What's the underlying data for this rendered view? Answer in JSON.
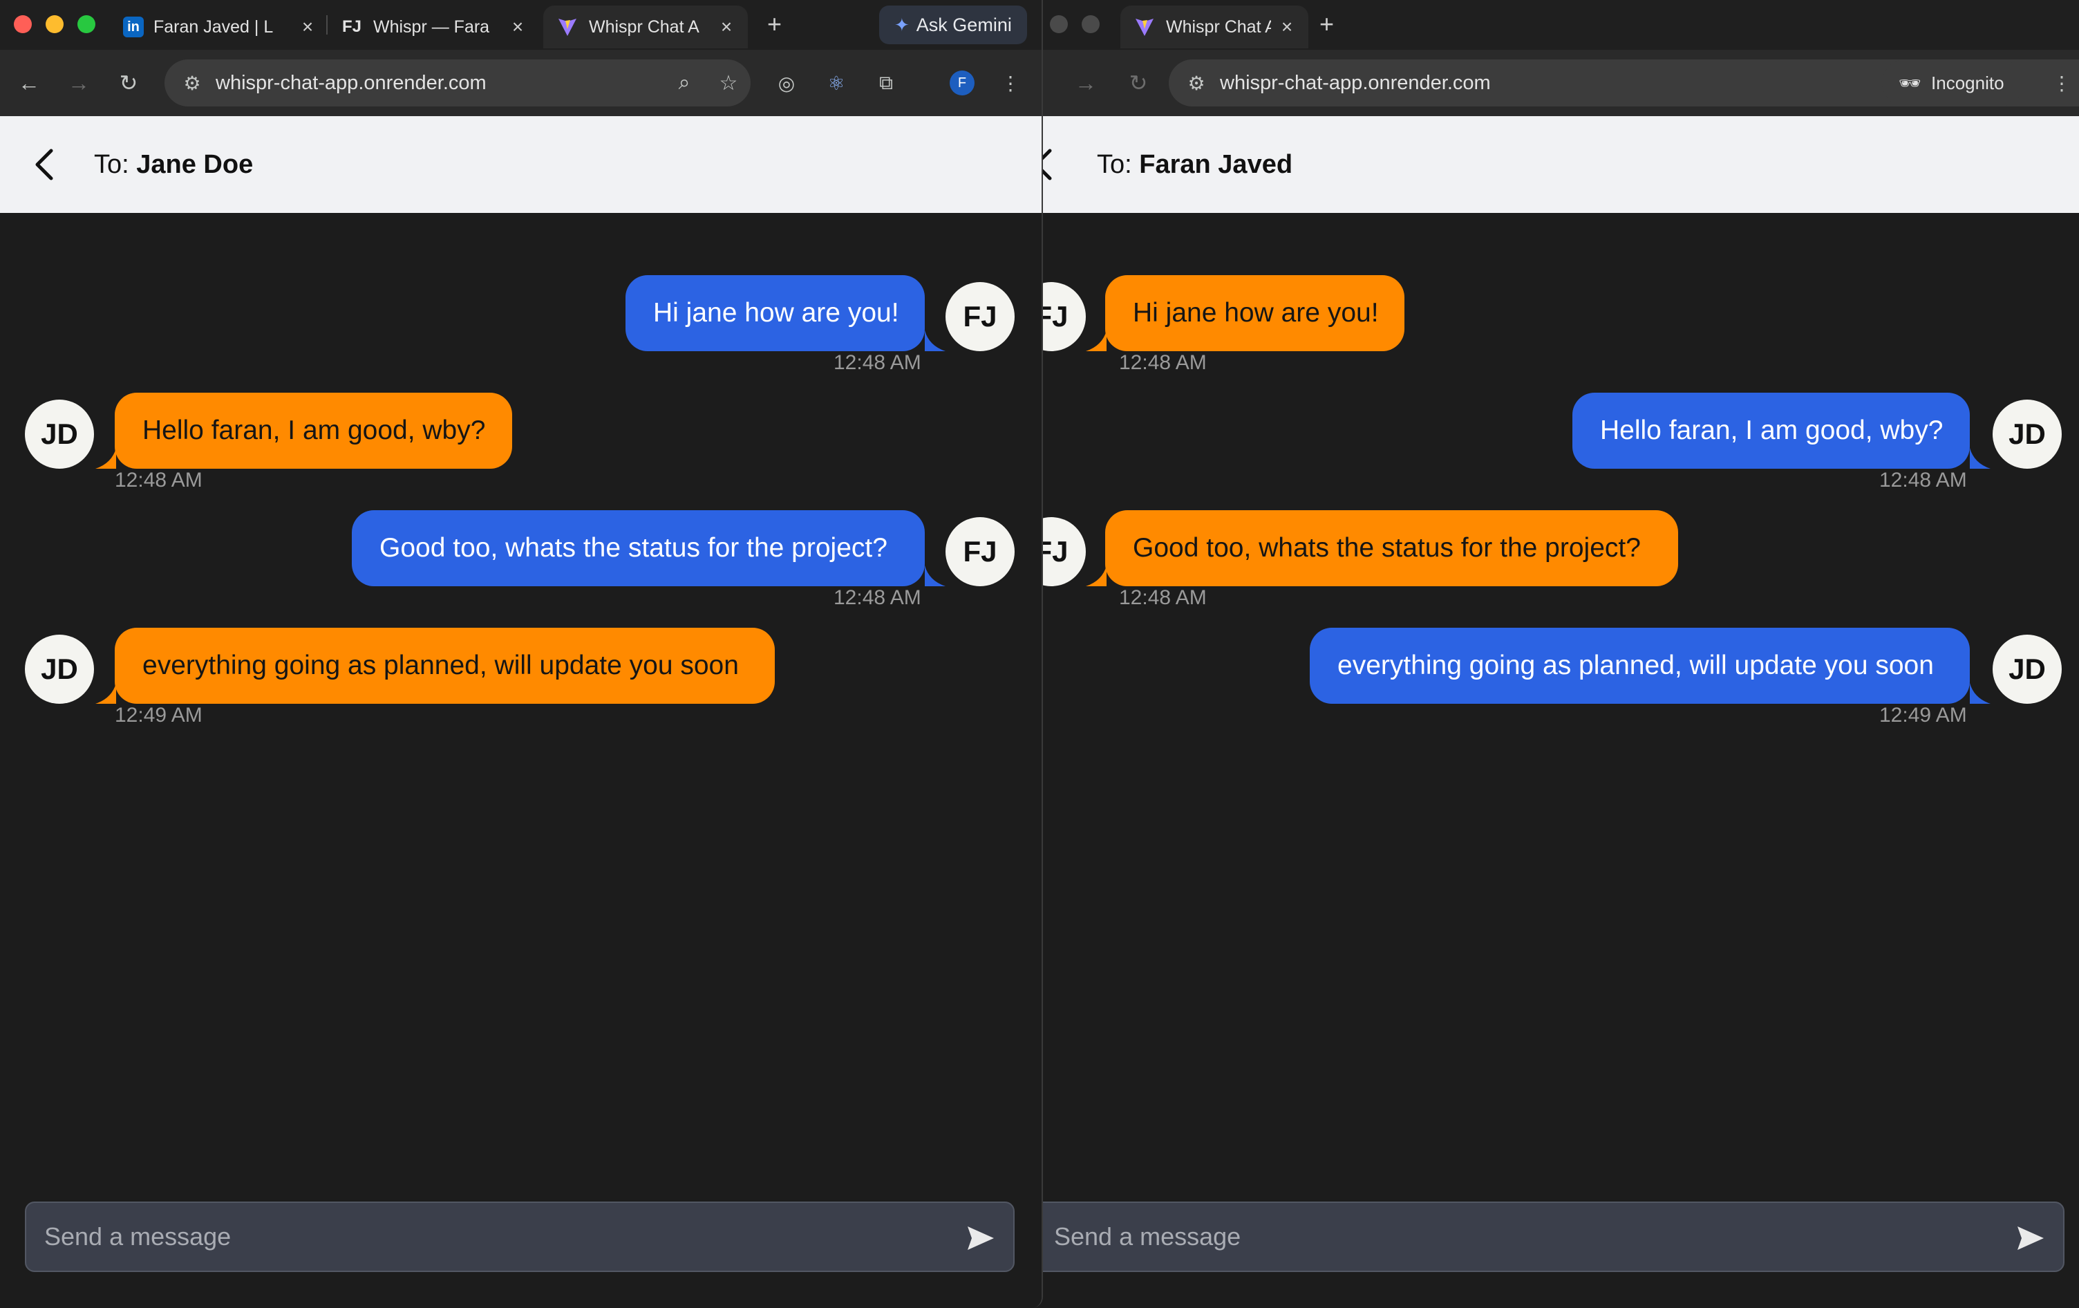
{
  "left_window": {
    "tabs": [
      {
        "icon": "in",
        "title": "Faran Javed | L"
      },
      {
        "icon": "FJ",
        "title": "Whispr — Fara"
      },
      {
        "icon": "V",
        "title": "Whispr Chat A"
      }
    ],
    "ask_gemini": "Ask Gemini",
    "url": "whispr-chat-app.onrender.com",
    "profile_initial": "F",
    "recipient_prefix": "To:",
    "recipient_name": "Jane Doe",
    "messages": [
      {
        "text": "Hi jane how are you!",
        "time": "12:48 AM",
        "avatar": "FJ"
      },
      {
        "text": "Hello faran, I am good, wby?",
        "time": "12:48 AM",
        "avatar": "JD"
      },
      {
        "text": "Good too, whats the status for the project?",
        "time": "12:48 AM",
        "avatar": "FJ"
      },
      {
        "text": "everything going as planned, will update you soon",
        "time": "12:49 AM",
        "avatar": "JD"
      }
    ],
    "composer_placeholder": "Send a message"
  },
  "right_window": {
    "tab_title": "Whispr Chat App",
    "url": "whispr-chat-app.onrender.com",
    "incognito_label": "Incognito",
    "recipient_prefix": "To:",
    "recipient_name": "Faran Javed",
    "messages": [
      {
        "text": "Hi jane how are you!",
        "time": "12:48 AM",
        "avatar": "FJ"
      },
      {
        "text": "Hello faran, I am good, wby?",
        "time": "12:48 AM",
        "avatar": "JD"
      },
      {
        "text": "Good too, whats the status for the project?",
        "time": "12:48 AM",
        "avatar": "FJ"
      },
      {
        "text": "everything going as planned, will update you soon",
        "time": "12:49 AM",
        "avatar": "JD"
      }
    ],
    "composer_placeholder": "Send a message"
  },
  "colors": {
    "sent_bubble": "#2c63e3",
    "received_bubble": "#ff8a00",
    "chat_background": "#1c1c1c",
    "header_background": "#f1f2f4",
    "composer": "#3b3f4b"
  }
}
